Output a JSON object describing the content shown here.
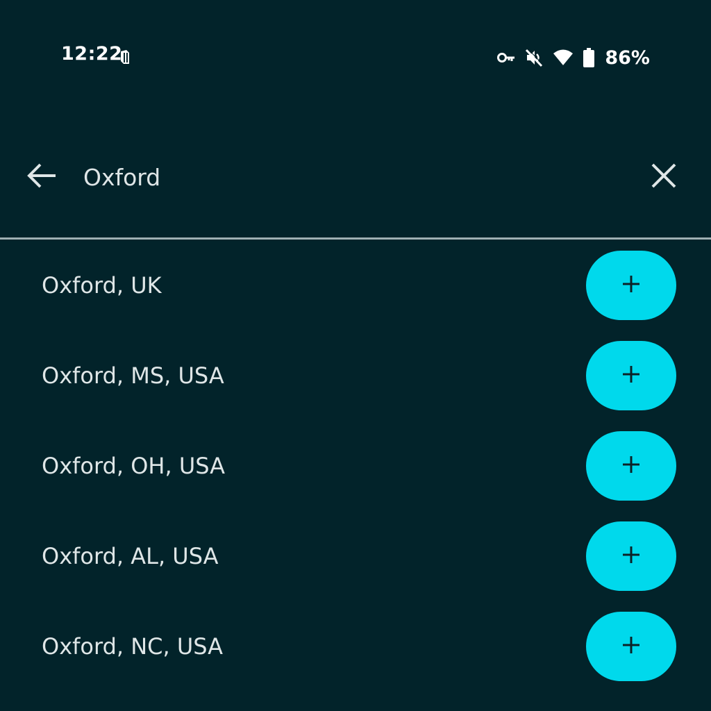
{
  "status_bar": {
    "time": "12:22",
    "battery_percent": "86%",
    "icons": [
      "notification-icon",
      "vpn-key-icon",
      "mute-icon",
      "wifi-icon",
      "battery-icon"
    ]
  },
  "search": {
    "query": "Oxford",
    "back_icon": "arrow-left-icon",
    "clear_icon": "close-icon"
  },
  "results": [
    {
      "label": "Oxford, UK"
    },
    {
      "label": "Oxford, MS, USA"
    },
    {
      "label": "Oxford, OH, USA"
    },
    {
      "label": "Oxford, AL, USA"
    },
    {
      "label": "Oxford, NC, USA"
    }
  ],
  "add_icon": "plus-icon",
  "colors": {
    "background": "#02232a",
    "accent": "#00d9ec",
    "text": "#dfe6e7",
    "divider": "#9fb0b3"
  }
}
